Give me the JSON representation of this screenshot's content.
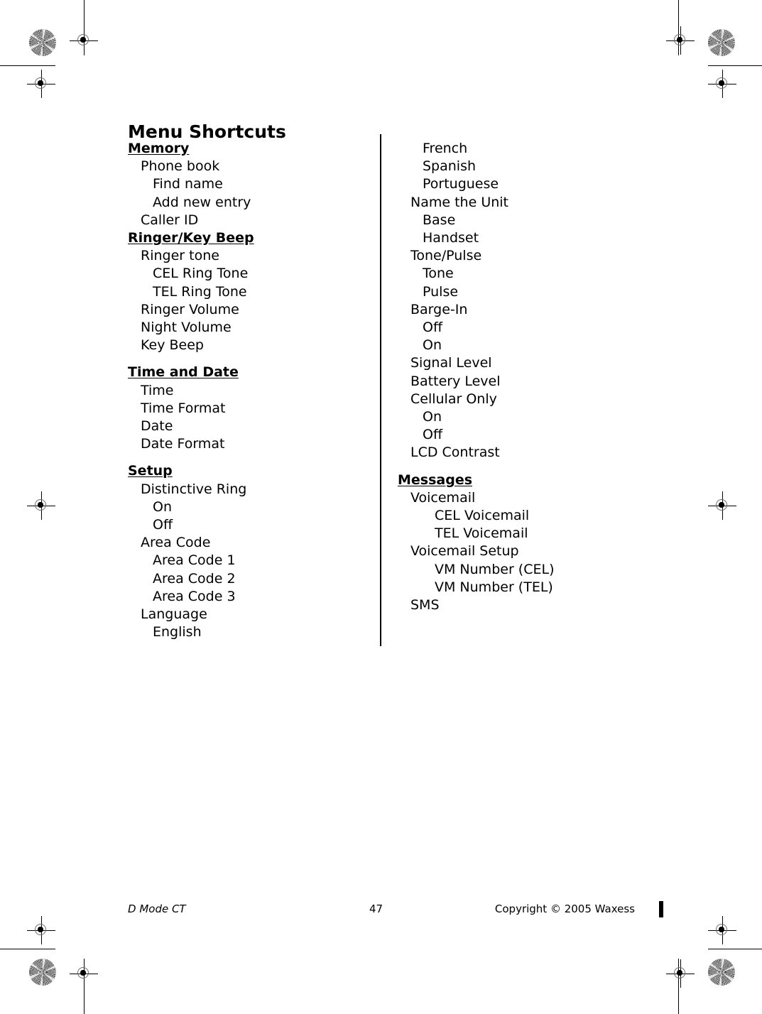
{
  "document": {
    "title": "Menu Shortcuts",
    "page_number": "47",
    "footer_left": "D Mode CT",
    "footer_right": "Copyright © 2005 Waxess"
  },
  "columns": {
    "left": [
      {
        "text": "Memory",
        "level": 0,
        "style": "head",
        "gap": false
      },
      {
        "text": "Phone book",
        "level": 1,
        "style": "item",
        "gap": false
      },
      {
        "text": "Find name",
        "level": 2,
        "style": "item",
        "gap": false
      },
      {
        "text": "Add new entry",
        "level": 2,
        "style": "item",
        "gap": false
      },
      {
        "text": "Caller ID",
        "level": 1,
        "style": "item",
        "gap": false
      },
      {
        "text": "Ringer/Key Beep",
        "level": 0,
        "style": "head",
        "gap": false
      },
      {
        "text": "Ringer tone",
        "level": 1,
        "style": "item",
        "gap": false
      },
      {
        "text": "CEL Ring Tone",
        "level": 2,
        "style": "item",
        "gap": false
      },
      {
        "text": "TEL Ring Tone",
        "level": 2,
        "style": "item",
        "gap": false
      },
      {
        "text": "Ringer Volume",
        "level": 1,
        "style": "item",
        "gap": false
      },
      {
        "text": "Night Volume",
        "level": 1,
        "style": "item",
        "gap": false
      },
      {
        "text": "Key Beep",
        "level": 1,
        "style": "item",
        "gap": false
      },
      {
        "text": "Time and Date",
        "level": 0,
        "style": "head",
        "gap": true
      },
      {
        "text": "Time",
        "level": 1,
        "style": "item",
        "gap": false
      },
      {
        "text": "Time Format",
        "level": 1,
        "style": "item",
        "gap": false
      },
      {
        "text": "Date",
        "level": 1,
        "style": "item",
        "gap": false
      },
      {
        "text": "Date Format",
        "level": 1,
        "style": "item",
        "gap": false
      },
      {
        "text": "Setup",
        "level": 0,
        "style": "head",
        "gap": true
      },
      {
        "text": "Distinctive Ring",
        "level": 1,
        "style": "item",
        "gap": false
      },
      {
        "text": "On",
        "level": 2,
        "style": "item",
        "gap": false
      },
      {
        "text": "Off",
        "level": 2,
        "style": "item",
        "gap": false
      },
      {
        "text": "Area Code",
        "level": 1,
        "style": "item",
        "gap": false
      },
      {
        "text": "Area Code 1",
        "level": 2,
        "style": "item",
        "gap": false
      },
      {
        "text": "Area Code 2",
        "level": 2,
        "style": "item",
        "gap": false
      },
      {
        "text": "Area Code 3",
        "level": 2,
        "style": "item",
        "gap": false
      },
      {
        "text": "Language",
        "level": 1,
        "style": "item",
        "gap": false
      },
      {
        "text": "English",
        "level": 2,
        "style": "item",
        "gap": false
      }
    ],
    "right": [
      {
        "text": "French",
        "level": 2,
        "style": "item",
        "gap": false
      },
      {
        "text": "Spanish",
        "level": 2,
        "style": "item",
        "gap": false
      },
      {
        "text": "Portuguese",
        "level": 2,
        "style": "item",
        "gap": false
      },
      {
        "text": "Name the Unit",
        "level": 1,
        "style": "item",
        "gap": false
      },
      {
        "text": "Base",
        "level": 2,
        "style": "item",
        "gap": false
      },
      {
        "text": "Handset",
        "level": 2,
        "style": "item",
        "gap": false
      },
      {
        "text": "Tone/Pulse",
        "level": 1,
        "style": "item",
        "gap": false
      },
      {
        "text": "Tone",
        "level": 2,
        "style": "item",
        "gap": false
      },
      {
        "text": "Pulse",
        "level": 2,
        "style": "item",
        "gap": false
      },
      {
        "text": "Barge-In",
        "level": 1,
        "style": "item",
        "gap": false
      },
      {
        "text": "Off",
        "level": 2,
        "style": "item",
        "gap": false
      },
      {
        "text": "On",
        "level": 2,
        "style": "item",
        "gap": false
      },
      {
        "text": "Signal Level",
        "level": 1,
        "style": "item",
        "gap": false
      },
      {
        "text": "Battery Level",
        "level": 1,
        "style": "item",
        "gap": false
      },
      {
        "text": "Cellular Only",
        "level": 1,
        "style": "item",
        "gap": false
      },
      {
        "text": "On",
        "level": 2,
        "style": "item",
        "gap": false
      },
      {
        "text": "Off",
        "level": 2,
        "style": "item",
        "gap": false
      },
      {
        "text": "LCD Contrast",
        "level": 1,
        "style": "item",
        "gap": false
      },
      {
        "text": "Messages",
        "level": 0,
        "style": "head",
        "gap": true
      },
      {
        "text": "Voicemail",
        "level": 1,
        "style": "item",
        "gap": false
      },
      {
        "text": "CEL Voicemail",
        "level": 3,
        "style": "item",
        "gap": false
      },
      {
        "text": "TEL Voicemail",
        "level": 3,
        "style": "item",
        "gap": false
      },
      {
        "text": "Voicemail Setup",
        "level": 1,
        "style": "item",
        "gap": false
      },
      {
        "text": "VM Number (CEL)",
        "level": 3,
        "style": "item",
        "gap": false
      },
      {
        "text": "VM Number (TEL)",
        "level": 3,
        "style": "item",
        "gap": false
      },
      {
        "text": "SMS",
        "level": 1,
        "style": "item",
        "gap": false
      }
    ]
  },
  "print_marks": {
    "registration_icon": "registration-target-icon",
    "burst_icon": "star-burst-target-icon",
    "edge_marker_icon": "page-edge-marker"
  }
}
